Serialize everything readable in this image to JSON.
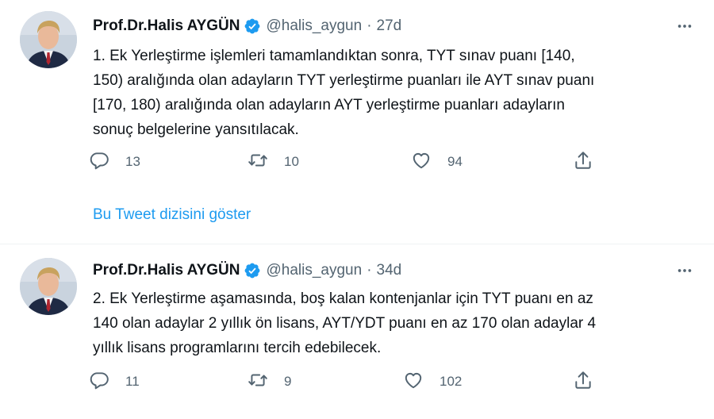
{
  "tweets": [
    {
      "author_name": "Prof.Dr.Halis AYGÜN",
      "handle": "@halis_aygun",
      "separator": "·",
      "time": "27d",
      "text_lines": [
        "1. Ek Yerleştirme işlemleri tamamlandıktan sonra, TYT sınav puanı [140,",
        "150) aralığında  olan adayların TYT yerleştirme puanları ile AYT sınav puanı",
        "[170, 180) aralığında olan adayların AYT yerleştirme puanları adayların",
        "sonuç belgelerine yansıtılacak."
      ],
      "replies": "13",
      "retweets": "10",
      "likes": "94",
      "show_thread": "Bu Tweet dizisini göster"
    },
    {
      "author_name": "Prof.Dr.Halis AYGÜN",
      "handle": "@halis_aygun",
      "separator": "·",
      "time": "34d",
      "text_lines": [
        "2. Ek Yerleştirme aşamasında, boş kalan kontenjanlar için TYT puanı en az",
        "140 olan adaylar 2 yıllık ön lisans, AYT/YDT puanı en az 170 olan adaylar 4",
        "yıllık lisans programlarını tercih edebilecek."
      ],
      "replies": "11",
      "retweets": "9",
      "likes": "102"
    }
  ],
  "icons": {
    "verified": "verified-badge-icon",
    "more": "more-options-icon",
    "reply": "reply-icon",
    "retweet": "retweet-icon",
    "like": "like-icon",
    "share": "share-icon"
  },
  "colors": {
    "text": "#0f1419",
    "secondary": "#536471",
    "link": "#1d9bf0",
    "verified": "#1d9bf0",
    "divider": "#eff3f4"
  }
}
